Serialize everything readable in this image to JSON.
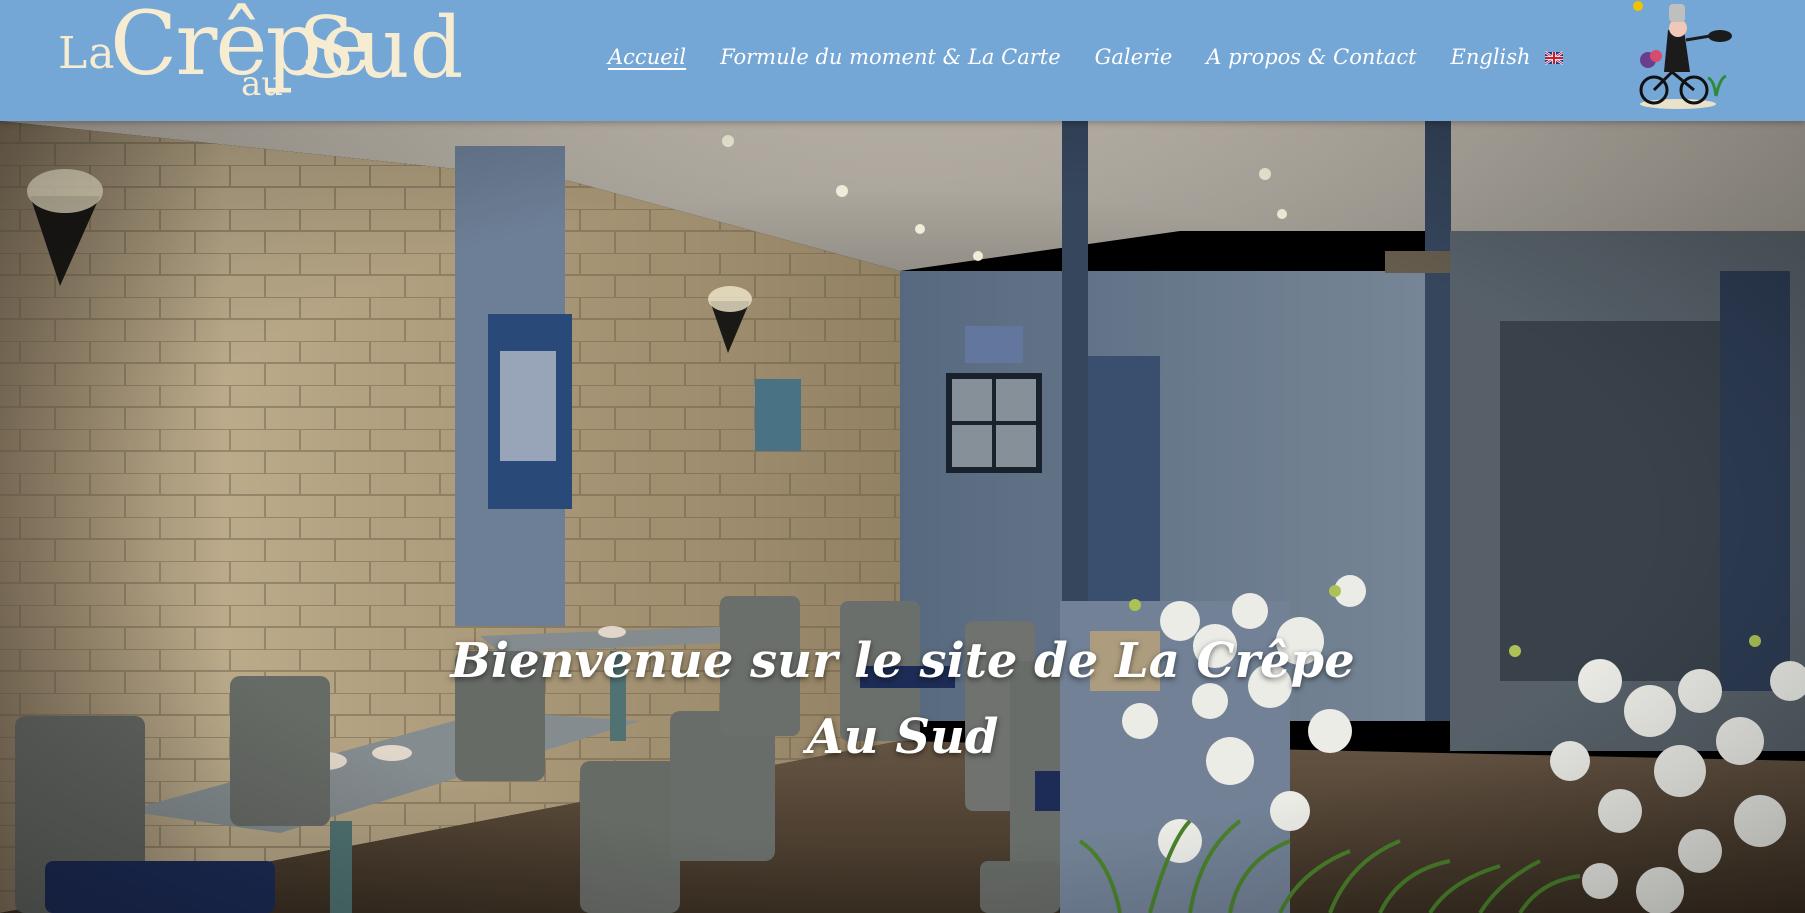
{
  "brand": {
    "logo_text": "La Crêpe au Sud",
    "logo_parts": {
      "la": "La",
      "crepe": "Crêpe",
      "au": "au",
      "sud": "Sud"
    }
  },
  "nav": {
    "items": [
      {
        "label": "Accueil",
        "active": true
      },
      {
        "label": "Formule du moment & La Carte",
        "active": false
      },
      {
        "label": "Galerie",
        "active": false
      },
      {
        "label": "A propos & Contact",
        "active": false
      },
      {
        "label": "English",
        "active": false,
        "icon": "uk-flag-icon"
      }
    ]
  },
  "hero": {
    "title_line1": "Bienvenue sur le site de La Crêpe",
    "title_line2": "Au Sud"
  },
  "colors": {
    "header_bg": "#74a6d6",
    "logo": "#f6ecd2",
    "nav_text": "#ffffff"
  },
  "icons": [
    "uk-flag-icon",
    "cyclist-mascot-icon"
  ]
}
